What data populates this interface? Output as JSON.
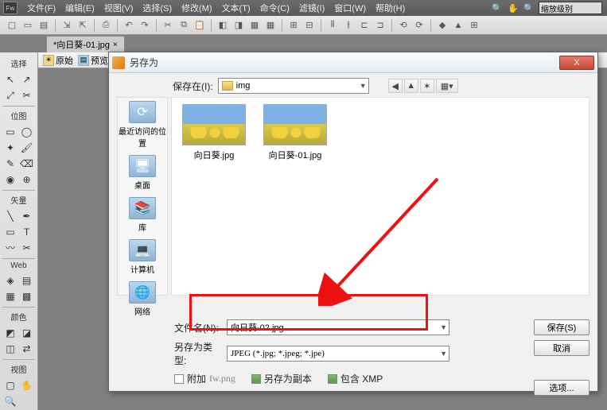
{
  "menubar": {
    "items": [
      "文件(F)",
      "编辑(E)",
      "视图(V)",
      "选择(S)",
      "修改(M)",
      "文本(T)",
      "命令(C)",
      "滤镜(I)",
      "窗口(W)",
      "帮助(H)"
    ],
    "zoom_field": "缩放级别"
  },
  "tab": {
    "label": "*向日葵-01.jpg",
    "close": "×"
  },
  "canvas_bar": {
    "original": "原始",
    "preview": "预览"
  },
  "left_panel": {
    "sections": [
      "选择",
      "位图",
      "矢量",
      "Web",
      "颜色",
      "视图"
    ]
  },
  "dialog": {
    "title": "另存为",
    "close": "X",
    "save_in_label": "保存在(I):",
    "save_in_value": "img",
    "places": [
      {
        "label": "最近访问的位置"
      },
      {
        "label": "桌面"
      },
      {
        "label": "库"
      },
      {
        "label": "计算机"
      },
      {
        "label": "网络"
      }
    ],
    "files": [
      {
        "name": "向日葵.jpg"
      },
      {
        "name": "向日葵-01.jpg"
      }
    ],
    "filename_label": "文件名(N):",
    "filename_value": "向日葵-02.jpg",
    "filetype_label": "另存为类型:",
    "filetype_value": "JPEG (*.jpg; *.jpeg; *.jpe)",
    "save_btn": "保存(S)",
    "cancel_btn": "取消",
    "options_btn": "选项...",
    "attach_label": "附加",
    "attach_file": "fw.png",
    "save_copy_label": "另存为副本",
    "include_xmp_label": "包含 XMP"
  }
}
